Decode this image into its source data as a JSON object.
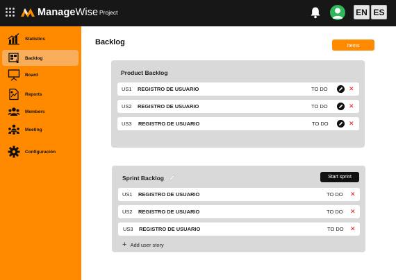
{
  "header": {
    "logo_text_a": "Manage",
    "logo_text_b": "Wise",
    "nav_project": "Project",
    "lang_en": "EN",
    "lang_es": "ES"
  },
  "sidebar": {
    "items": [
      {
        "label": "Statistics",
        "icon": "bar-chart-icon"
      },
      {
        "label": "Backlog",
        "icon": "backlog-board-icon",
        "active": true
      },
      {
        "label": "Board",
        "icon": "presentation-board-icon"
      },
      {
        "label": "Reports",
        "icon": "report-document-icon"
      },
      {
        "label": "Members",
        "icon": "people-group-icon"
      },
      {
        "label": "Meeting",
        "icon": "meeting-icon"
      },
      {
        "label": "Configuración",
        "icon": "gear-icon"
      }
    ]
  },
  "main": {
    "title": "Backlog",
    "items_button": "Items",
    "product_backlog": {
      "title": "Product Backlog",
      "rows": [
        {
          "id": "US1",
          "name": "REGISTRO DE USUARIO",
          "status": "TO DO"
        },
        {
          "id": "US2",
          "name": "REGISTRO DE USUARIO",
          "status": "TO DO"
        },
        {
          "id": "US3",
          "name": "REGISTRO DE USUARIO",
          "status": "TO DO"
        }
      ]
    },
    "sprint_backlog": {
      "title": "Sprint Backlog",
      "start_button": "Start sprint",
      "rows": [
        {
          "id": "US1",
          "name": "REGISTRO DE USUARIO",
          "status": "TO DO"
        },
        {
          "id": "US2",
          "name": "REGISTRO DE USUARIO",
          "status": "TO DO"
        },
        {
          "id": "US3",
          "name": "REGISTRO DE USUARIO",
          "status": "TO DO"
        }
      ],
      "add_story": "Add user story"
    }
  },
  "colors": {
    "accent": "#ff8a00",
    "topbar": "#171717",
    "panel": "#d9d9d9",
    "delete": "#ee1111"
  }
}
